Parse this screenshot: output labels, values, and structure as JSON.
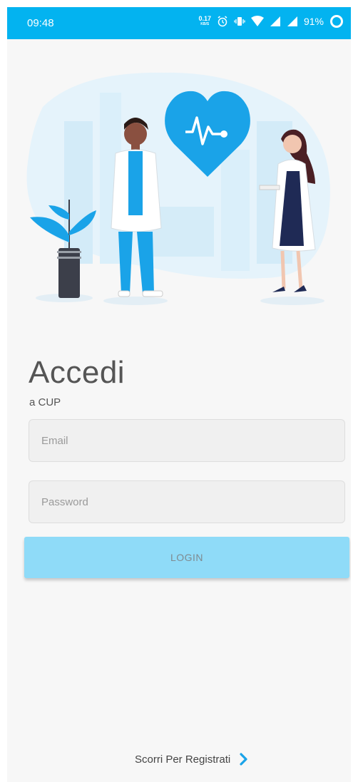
{
  "status_bar": {
    "time": "09:48",
    "net_speed_value": "0.17",
    "net_speed_unit": "KB/S",
    "battery": "91%"
  },
  "login": {
    "title": "Accedi",
    "subtitle": "a CUP",
    "email_placeholder": "Email",
    "password_placeholder": "Password",
    "login_button": "LOGIN",
    "register_link": "Scorri Per Registrati"
  },
  "colors": {
    "status_bar": "#03b3f0",
    "accent": "#1aa3e8",
    "login_button": "#8fdbf8",
    "background": "#f7f7f7"
  }
}
